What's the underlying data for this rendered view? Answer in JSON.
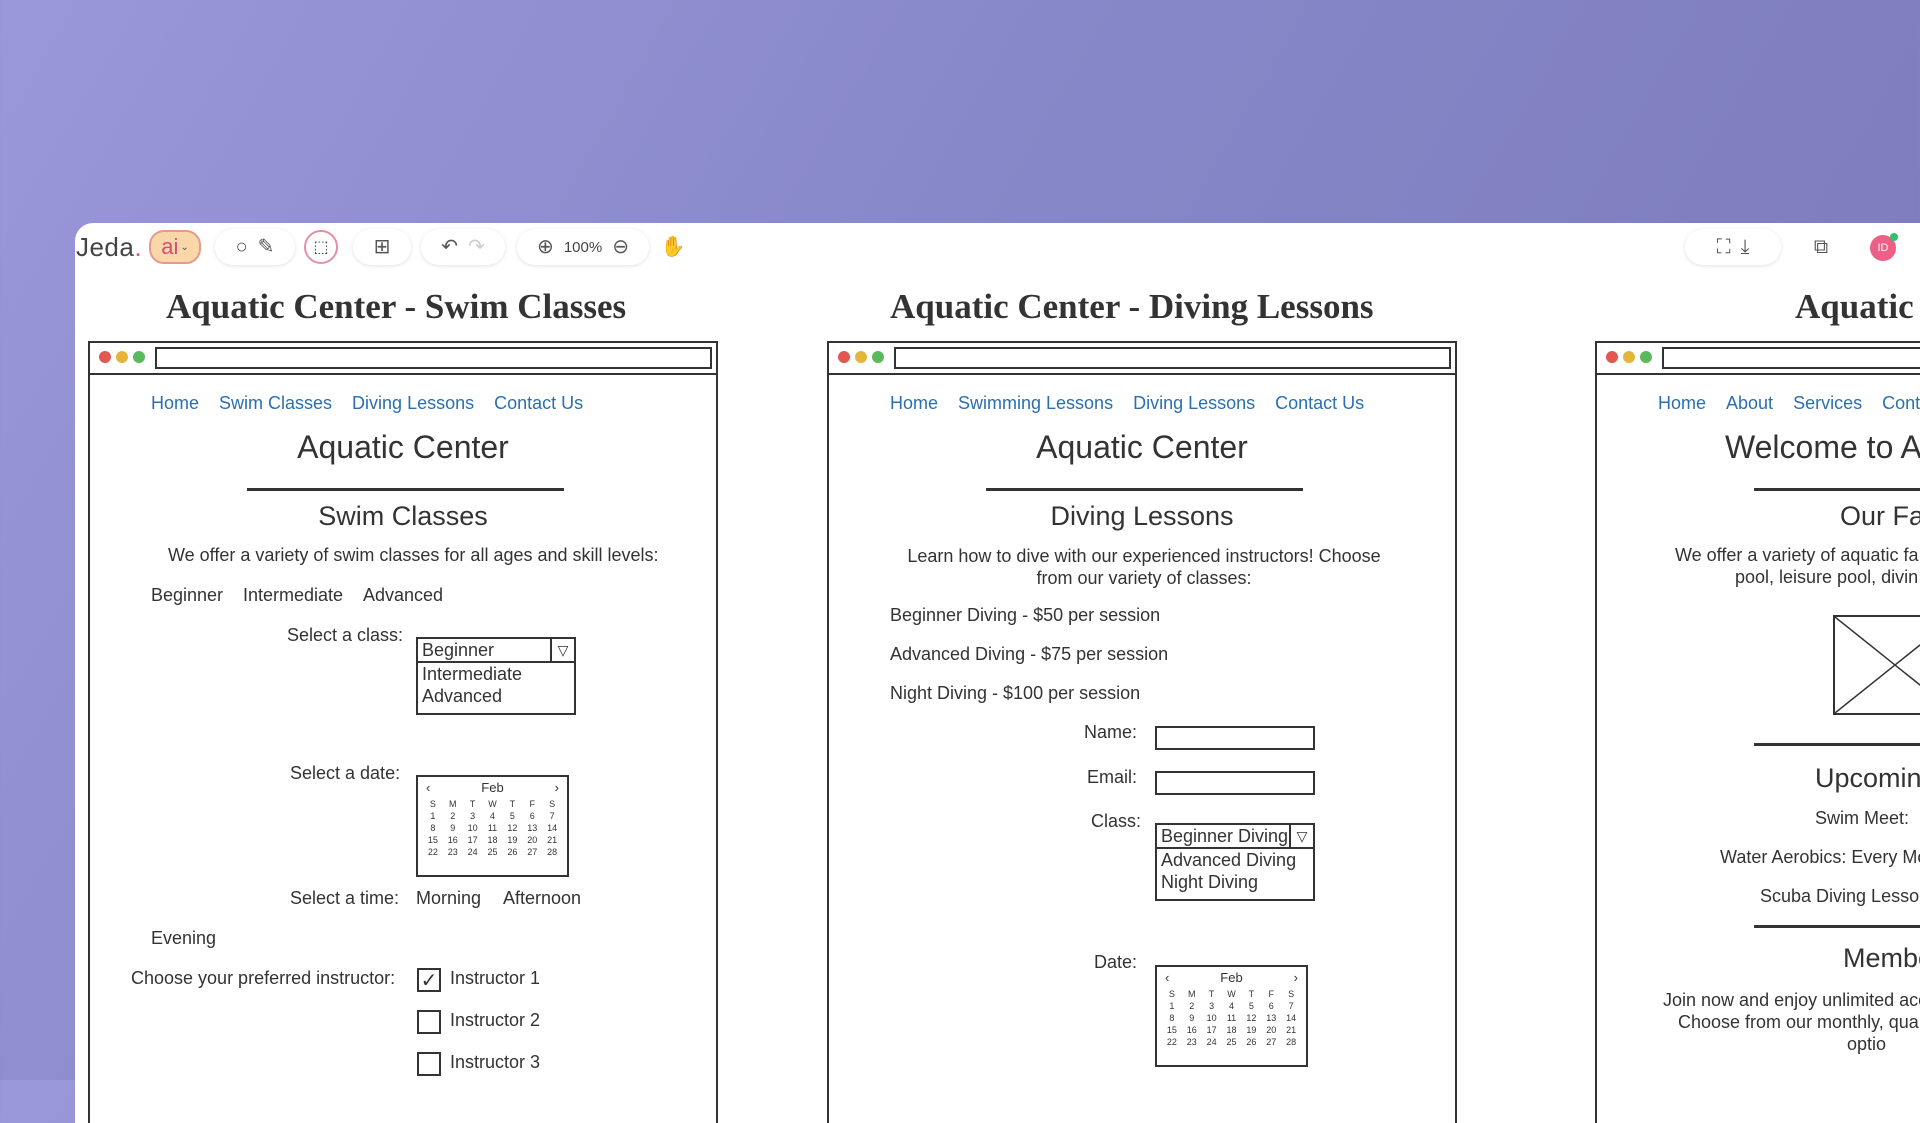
{
  "toolbar": {
    "logo_text": "Jeda",
    "logo_accent": ".",
    "ai_label": "ai",
    "zoom": "100%",
    "avatar_initials": "ID"
  },
  "boards": [
    {
      "title": "Aquatic Center - Swim Classes",
      "nav": [
        "Home",
        "Swim Classes",
        "Diving Lessons",
        "Contact Us"
      ],
      "site_title": "Aquatic Center",
      "section_title": "Swim Classes",
      "intro": "We offer a variety of swim classes for all ages and skill levels:",
      "levels": [
        "Beginner",
        "Intermediate",
        "Advanced"
      ],
      "select_class_label": "Select a class:",
      "class_select": {
        "selected": "Beginner",
        "options": [
          "Intermediate",
          "Advanced"
        ]
      },
      "select_date_label": "Select a date:",
      "select_time_label": "Select a time:",
      "times": [
        "Morning",
        "Afternoon",
        "Evening"
      ],
      "instructor_label": "Choose your preferred instructor:",
      "instructors": [
        {
          "label": "Instructor 1",
          "checked": true
        },
        {
          "label": "Instructor 2",
          "checked": false
        },
        {
          "label": "Instructor 3",
          "checked": false
        }
      ]
    },
    {
      "title": "Aquatic Center - Diving Lessons",
      "nav": [
        "Home",
        "Swimming Lessons",
        "Diving Lessons",
        "Contact Us"
      ],
      "site_title": "Aquatic Center",
      "section_title": "Diving Lessons",
      "intro": "Learn how to dive with our experienced instructors! Choose from our variety of classes:",
      "classes": [
        "Beginner Diving - $50 per session",
        "Advanced Diving - $75 per session",
        "Night Diving - $100 per session"
      ],
      "name_label": "Name:",
      "email_label": "Email:",
      "class_label": "Class:",
      "class_select": {
        "selected": "Beginner Diving",
        "options": [
          "Advanced Diving",
          "Night Diving"
        ]
      },
      "date_label": "Date:"
    },
    {
      "title": "Aquatic",
      "nav": [
        "Home",
        "About",
        "Services",
        "Conta"
      ],
      "site_title": "Welcome to A",
      "section_title": "Our Fa",
      "intro_line1": "We offer a variety of aquatic fa",
      "intro_line2": "pool, leisure pool, divin",
      "upcoming_title": "Upcomin",
      "events": [
        "Swim Meet:",
        "Water Aerobics: Every Mo",
        "Scuba Diving Lesson"
      ],
      "member_title": "Membe",
      "member_line1": "Join now and enjoy unlimited acc",
      "member_line2": "Choose from our monthly, qua",
      "member_line3": "optio"
    }
  ],
  "calendar": {
    "month": "Feb",
    "weekdays": [
      "S",
      "M",
      "T",
      "W",
      "T",
      "F",
      "S"
    ],
    "days": [
      "1",
      "2",
      "3",
      "4",
      "5",
      "6",
      "7",
      "8",
      "9",
      "10",
      "11",
      "12",
      "13",
      "14",
      "15",
      "16",
      "17",
      "18",
      "19",
      "20",
      "21",
      "22",
      "23",
      "24",
      "25",
      "26",
      "27",
      "28"
    ]
  }
}
